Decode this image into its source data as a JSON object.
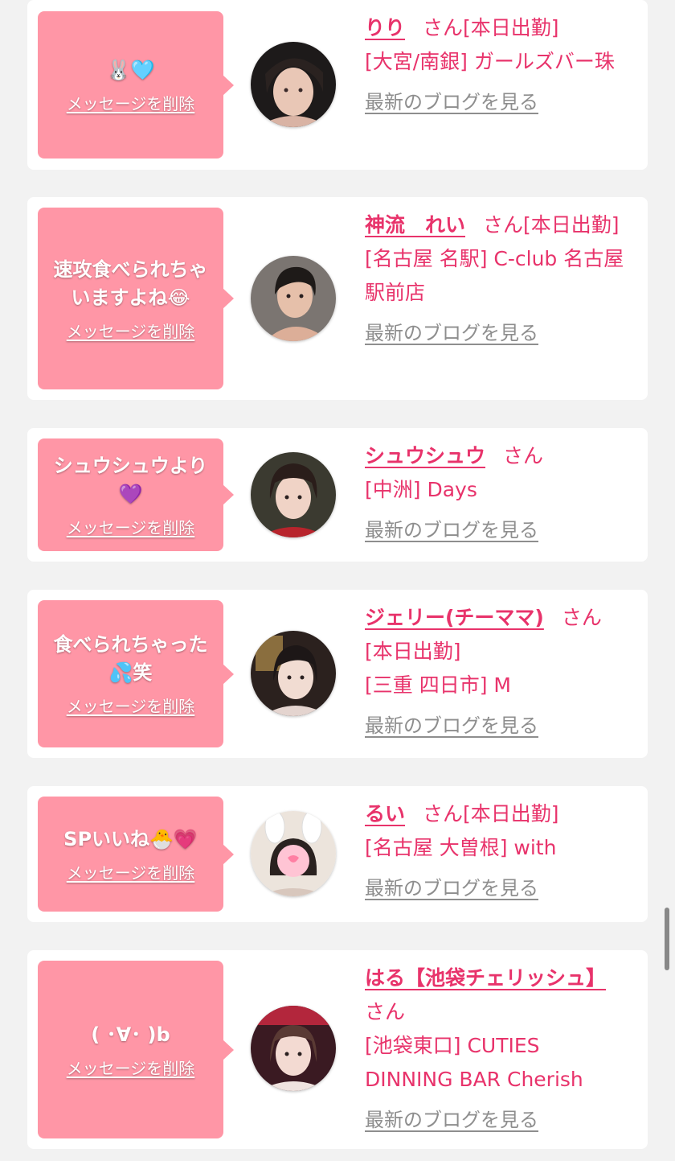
{
  "delete_label": "メッセージを削除",
  "blog_label": "最新のブログを見る",
  "honorific": "さん",
  "colors": {
    "accent": "#e8336b",
    "bubble": "#ff96a6",
    "link_gray": "#8e8e8e",
    "background": "#f2f2f2"
  },
  "items": [
    {
      "message": "🐰🩵",
      "name": "りり",
      "tag": "[本日出勤]",
      "shop": "[大宮/南銀] ガールズバー珠"
    },
    {
      "message": "速攻食べられちゃいますよね😂",
      "name": "神流　れい",
      "tag": "[本日出勤]",
      "shop": "[名古屋 名駅] C-club 名古屋駅前店"
    },
    {
      "message": "シュウシュウより💜",
      "name": "シュウシュウ",
      "tag": "",
      "shop": "[中洲] Days"
    },
    {
      "message": "食べられちゃった💦笑",
      "name": "ジェリー(チーママ)",
      "tag": "[本日出勤]",
      "shop": "[三重 四日市] M"
    },
    {
      "message": "SPいいね🐣💗",
      "name": "るい",
      "tag": "[本日出勤]",
      "shop": "[名古屋 大曽根] with"
    },
    {
      "message": "( ･∀･ )b",
      "name": "はる【池袋チェリッシュ】",
      "tag": "",
      "shop": "[池袋東口] CUTIES DINNING BAR Cherish"
    }
  ]
}
